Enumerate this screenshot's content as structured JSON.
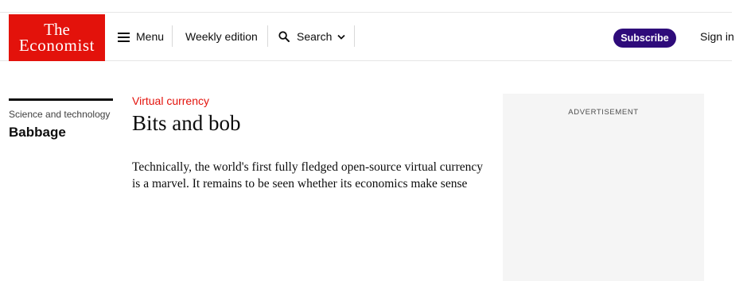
{
  "header": {
    "logo": {
      "line1": "The",
      "line2": "Economist"
    },
    "menu_label": "Menu",
    "weekly_edition_label": "Weekly edition",
    "search_label": "Search",
    "subscribe_label": "Subscribe",
    "signin_label": "Sign in"
  },
  "rail": {
    "section": "Science and technology",
    "title": "Babbage"
  },
  "article": {
    "kicker": "Virtual currency",
    "headline": "Bits and bob",
    "standfirst": "Technically, the world's first fully fledged open-source virtual currency is a marvel. It remains to be seen whether its economics make sense"
  },
  "ad": {
    "label": "ADVERTISEMENT"
  },
  "colors": {
    "brand_red": "#e3120b",
    "subscribe_purple": "#2e0b7a",
    "ad_background": "#f5f5f5"
  },
  "icons": {
    "menu": "hamburger-icon",
    "search": "search-icon",
    "search_dropdown": "chevron-down-icon"
  }
}
